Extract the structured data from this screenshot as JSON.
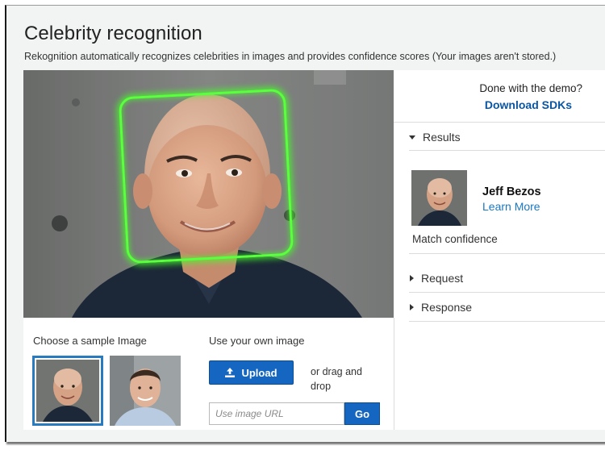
{
  "header": {
    "title": "Celebrity recognition",
    "subtitle": "Rekognition automatically recognizes celebrities in images and provides confidence scores (Your images aren't stored.)"
  },
  "demo_panel": {
    "done_text": "Done with the demo?",
    "sdk_link": "Download SDKs"
  },
  "results": {
    "section_label": "Results",
    "celebrity_name": "Jeff Bezos",
    "learn_more": "Learn More",
    "match_confidence_label": "Match confidence"
  },
  "collapsed_sections": {
    "request": "Request",
    "response": "Response"
  },
  "samples": {
    "label": "Choose a sample Image"
  },
  "own_image": {
    "label": "Use your own image",
    "upload_label": "Upload",
    "drag_text": "or drag and drop",
    "url_placeholder": "Use image URL",
    "go_label": "Go"
  },
  "colors": {
    "accent": "#1466c0",
    "link": "#1a78c2",
    "sdk_link": "#0a56a4",
    "face_box": "#5aff3e",
    "selected_border": "#2a7abf"
  },
  "icons": {
    "upload": "upload-icon",
    "results_caret": "caret-down-icon",
    "request_caret": "caret-right-icon",
    "response_caret": "caret-right-icon"
  }
}
